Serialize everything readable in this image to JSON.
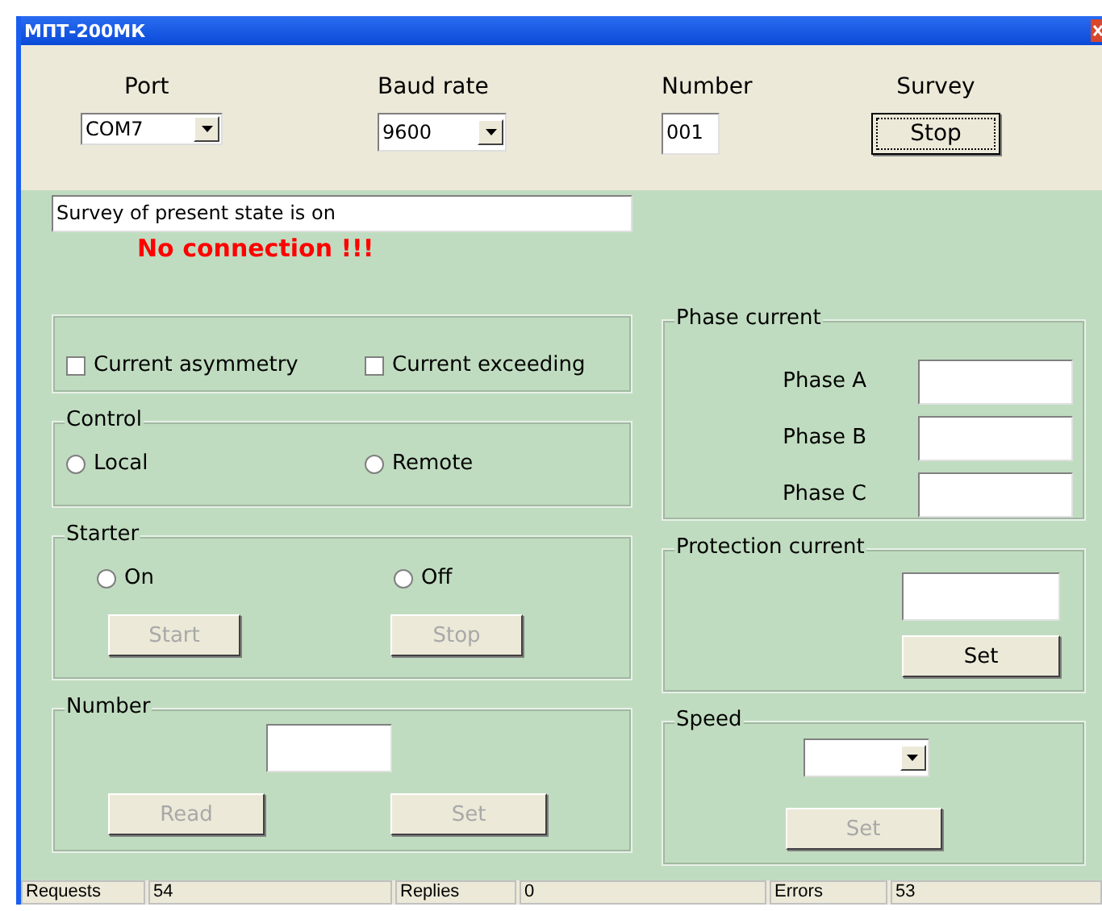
{
  "window": {
    "title": "МПТ-200МК"
  },
  "toolbar": [
    {
      "kind": "dropdown",
      "label": "Port",
      "value": "COM7"
    },
    {
      "kind": "dropdown",
      "label": "Baud rate",
      "value": "9600"
    },
    {
      "kind": "field",
      "label": "Number",
      "value": "001"
    },
    {
      "kind": "button",
      "label": "Survey",
      "value": "Stop"
    }
  ],
  "status_field": {
    "value": "Survey of present state is on"
  },
  "alert": "No connection !!!",
  "alarms": [
    {
      "label": "Current asymmetry",
      "checked": false
    },
    {
      "label": "Current exceeding",
      "checked": false
    }
  ],
  "control": {
    "title": "Control",
    "options": [
      {
        "label": "Local",
        "selected": false
      },
      {
        "label": "Remote",
        "selected": false
      }
    ]
  },
  "starter": {
    "title": "Starter",
    "options": [
      {
        "label": "On",
        "selected": false
      },
      {
        "label": "Off",
        "selected": false
      }
    ],
    "buttons": [
      {
        "label": "Start",
        "disabled": true
      },
      {
        "label": "Stop",
        "disabled": true
      }
    ]
  },
  "number": {
    "title": "Number",
    "buttons": [
      {
        "label": "Read",
        "disabled": true
      },
      {
        "label": "Set",
        "disabled": true
      }
    ]
  },
  "phase_current": {
    "title": "Phase current",
    "phases": [
      {
        "label": "Phase A"
      },
      {
        "label": "Phase B"
      },
      {
        "label": "Phase C"
      }
    ]
  },
  "protection_current": {
    "title": "Protection current",
    "button": {
      "label": "Set",
      "disabled": false
    }
  },
  "speed": {
    "title": "Speed",
    "button": {
      "label": "Set",
      "disabled": true
    }
  },
  "status_bar": [
    {
      "label": "Requests",
      "value": "54"
    },
    {
      "label": "Replies",
      "value": "0"
    },
    {
      "label": "Errors",
      "value": "53"
    }
  ]
}
